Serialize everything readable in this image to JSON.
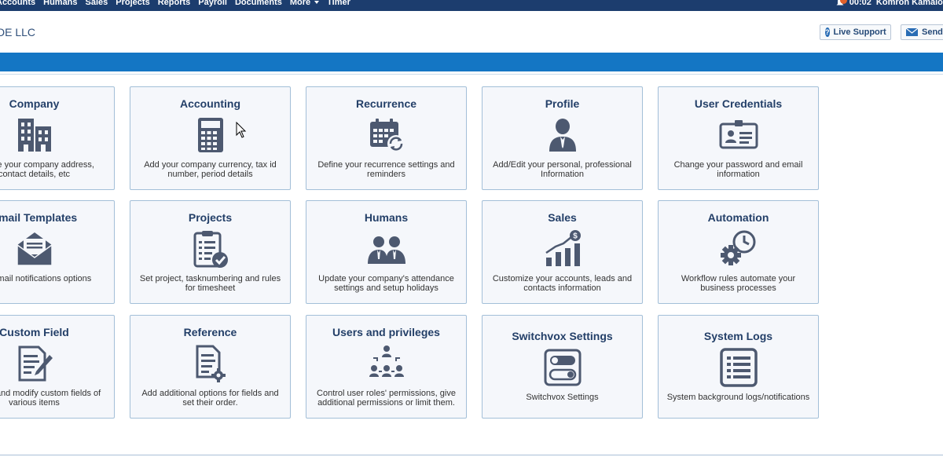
{
  "nav": {
    "items": [
      "Accounts",
      "Humans",
      "Sales",
      "Projects",
      "Reports",
      "Payroll",
      "Documents",
      "More",
      "Timer"
    ],
    "timer": "00:02",
    "user": "Komron Kamalov"
  },
  "header": {
    "company": "DE LLC",
    "live_support": "Live Support",
    "send": "Send"
  },
  "colors": {
    "nav_bg": "#1c3d6e",
    "band": "#1476c4",
    "tile_title": "#233f68",
    "icon": "#4d5970"
  },
  "tiles": [
    {
      "title": "Company",
      "icon": "building-icon",
      "desc": "Update your company address, contact details, etc"
    },
    {
      "title": "Accounting",
      "icon": "calculator-icon",
      "desc": "Add your company currency, tax id number, period details"
    },
    {
      "title": "Recurrence",
      "icon": "calendar-refresh-icon",
      "desc": "Define your recurrence settings and reminders"
    },
    {
      "title": "Profile",
      "icon": "user-profile-icon",
      "desc": "Add/Edit your personal, professional Information"
    },
    {
      "title": "User Credentials",
      "icon": "id-card-icon",
      "desc": "Change your password and email information"
    },
    {
      "title": "Email Templates",
      "icon": "envelope-open-icon",
      "desc": "Set email notifications options"
    },
    {
      "title": "Projects",
      "icon": "clipboard-check-icon",
      "desc": "Set project, tasknumbering and rules for timesheet"
    },
    {
      "title": "Humans",
      "icon": "people-icon",
      "desc": "Update your company's attendance settings and setup holidays"
    },
    {
      "title": "Sales",
      "icon": "chart-growth-icon",
      "desc": "Customize your accounts, leads and contacts information"
    },
    {
      "title": "Automation",
      "icon": "gear-clock-icon",
      "desc": "Workflow rules automate your business processes"
    },
    {
      "title": "Custom Field",
      "icon": "document-pen-icon",
      "desc": "Create and modify custom fields of various items"
    },
    {
      "title": "Reference",
      "icon": "document-gear-icon",
      "desc": "Add additional options for fields and set their order."
    },
    {
      "title": "Users and privileges",
      "icon": "users-hierarchy-icon",
      "desc": "Control user roles' permissions, give additional permissions or limit them."
    },
    {
      "title": "Switchvox Settings",
      "icon": "toggle-switch-icon",
      "desc": "Switchvox Settings"
    },
    {
      "title": "System Logs",
      "icon": "list-log-icon",
      "desc": "System background logs/notifications"
    }
  ]
}
